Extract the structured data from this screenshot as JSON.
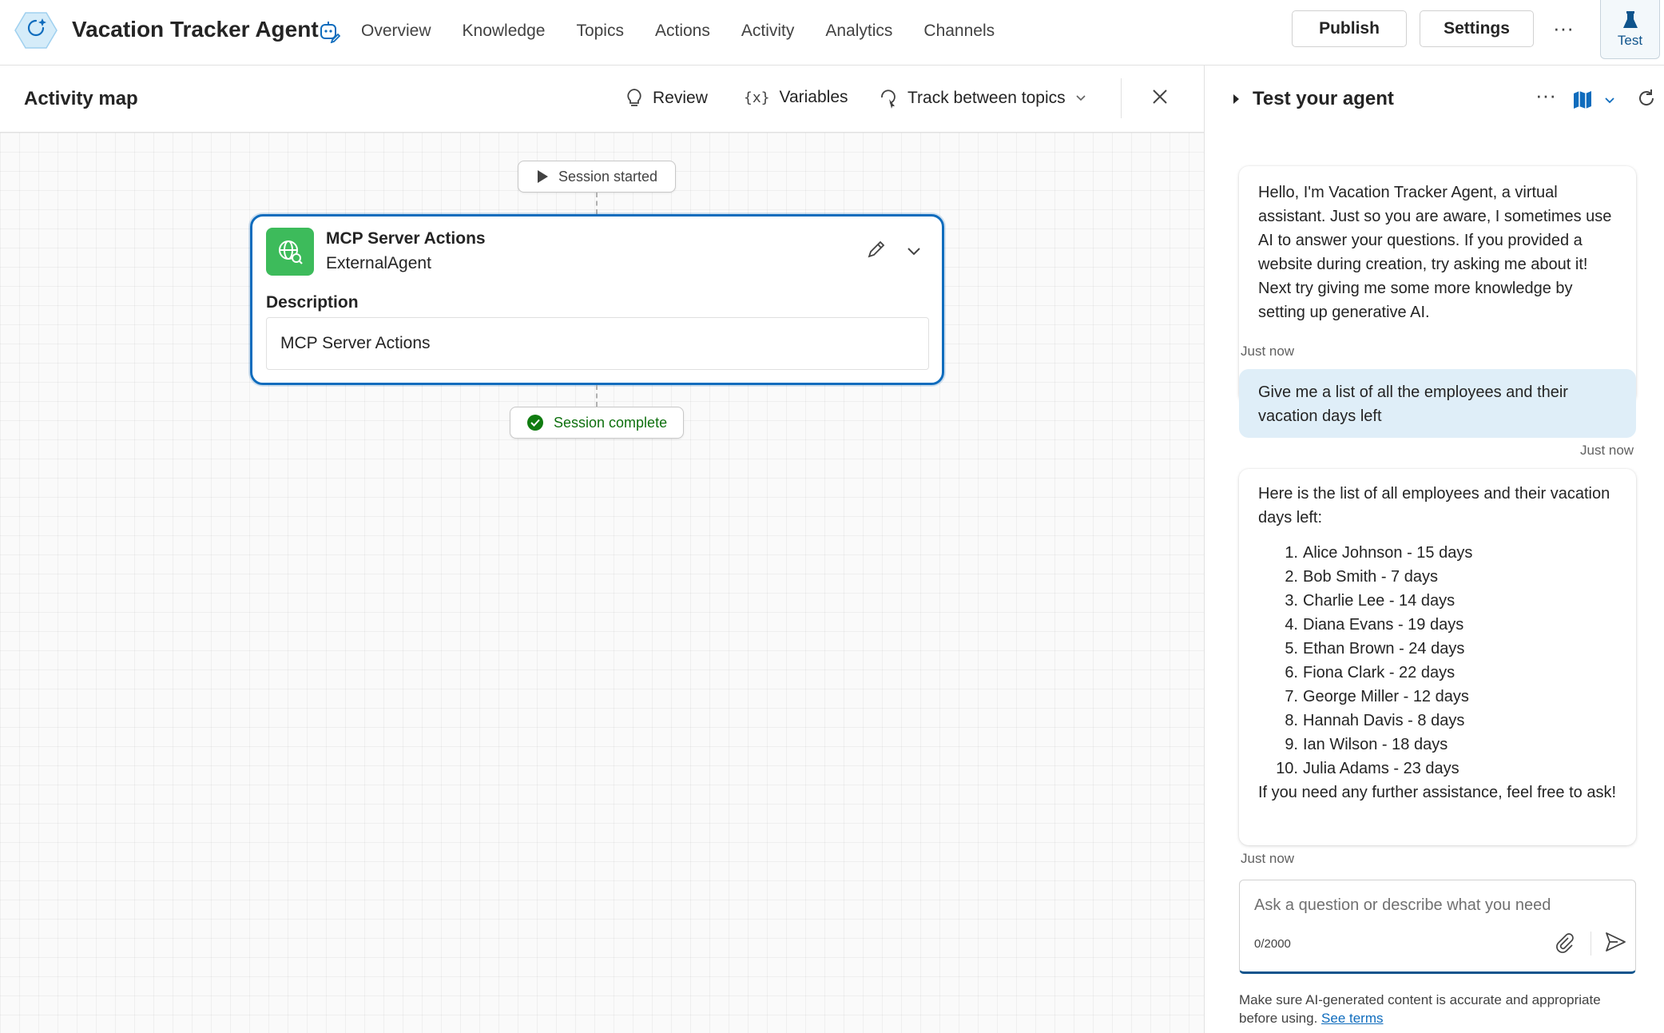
{
  "app": {
    "title": "Vacation Tracker Agent"
  },
  "nav": {
    "items": [
      "Overview",
      "Knowledge",
      "Topics",
      "Actions",
      "Activity",
      "Analytics",
      "Channels"
    ]
  },
  "toolbar": {
    "publish_label": "Publish",
    "settings_label": "Settings",
    "more_label": "···",
    "test_label": "Test"
  },
  "activity_map": {
    "title": "Activity map",
    "review_label": "Review",
    "variables_label": "Variables",
    "track_label": "Track between topics",
    "session_started": "Session started",
    "session_complete": "Session complete",
    "card": {
      "title": "MCP Server Actions",
      "subtitle": "ExternalAgent",
      "description_label": "Description",
      "description_value": "MCP Server Actions"
    }
  },
  "test_panel": {
    "title": "Test your agent",
    "more_label": "···",
    "messages": [
      {
        "role": "bot",
        "text": "Hello, I'm Vacation Tracker Agent, a virtual assistant. Just so you are aware, I sometimes use AI to answer your questions. If you provided a website during creation, try asking me about it! Next try giving me some more knowledge by setting up generative AI.",
        "time": "Just now"
      },
      {
        "role": "user",
        "text": "Give me a list of all the employees and their vacation days left",
        "time": "Just now"
      },
      {
        "role": "bot",
        "intro": "Here is the list of all employees and their vacation days left:",
        "list": [
          {
            "num": "1.",
            "text": "Alice Johnson - 15 days"
          },
          {
            "num": "2.",
            "text": "Bob Smith - 7 days"
          },
          {
            "num": "3.",
            "text": "Charlie Lee - 14 days"
          },
          {
            "num": "4.",
            "text": "Diana Evans - 19 days"
          },
          {
            "num": "5.",
            "text": "Ethan Brown - 24 days"
          },
          {
            "num": "6.",
            "text": "Fiona Clark - 22 days"
          },
          {
            "num": "7.",
            "text": "George Miller - 12 days"
          },
          {
            "num": "8.",
            "text": "Hannah Davis - 8 days"
          },
          {
            "num": "9.",
            "text": "Ian Wilson - 18 days"
          },
          {
            "num": "10.",
            "text": "Julia Adams - 23 days"
          }
        ],
        "outro": "If you need any further assistance, feel free to ask!",
        "time": "Just now"
      }
    ],
    "compose": {
      "placeholder": "Ask a question or describe what you need",
      "value": "",
      "count": "0/2000"
    },
    "disclaimer": "Make sure AI-generated content is accurate and appropriate before using.",
    "terms_link": "See terms"
  },
  "colors": {
    "accent": "#0f6cbd",
    "card_icon": "#3dbb5b",
    "success": "#0e700e",
    "user_bubble": "#dfeef8"
  },
  "icons": {
    "logo": "copilot-hexagon-icon",
    "title_edit": "agent-edit-icon",
    "test": "flask-icon",
    "review": "lightbulb-icon",
    "variables": "variables-icon",
    "track": "track-topics-icon",
    "close": "close-icon",
    "play": "play-icon",
    "check": "check-circle-icon",
    "globe": "globe-search-icon",
    "edit": "pencil-icon",
    "chevron": "chevron-down-icon",
    "map": "map-icon",
    "refresh": "refresh-icon",
    "attach": "paperclip-icon",
    "send": "send-icon"
  }
}
